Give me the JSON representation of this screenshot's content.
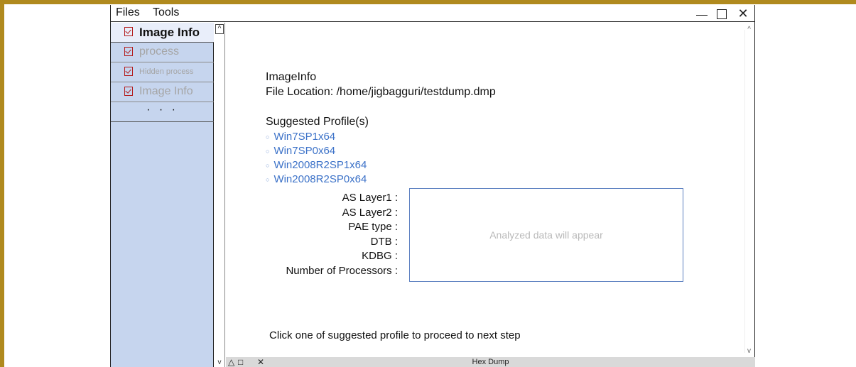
{
  "menu": {
    "files": "Files",
    "tools": "Tools"
  },
  "window_controls": {
    "minimize_icon": "minimize-icon",
    "maximize_icon": "maximize-icon",
    "close_glyph": "✕"
  },
  "sidebar": {
    "items": [
      {
        "label": "Image Info",
        "active": true
      },
      {
        "label": "process",
        "active": false
      },
      {
        "label": "Hidden process",
        "active": false
      },
      {
        "label": "Image Info",
        "active": false
      }
    ],
    "more_label": "· · ·"
  },
  "content": {
    "title": "ImageInfo",
    "file_location": "File Location: /home/jigbagguri/testdump.dmp",
    "suggested_heading": "Suggested Profile(s)",
    "profiles": [
      "Win7SP1x64",
      "Win7SP0x64",
      "Win2008R2SP1x64",
      "Win2008R2SP0x64"
    ],
    "fields": [
      "AS Layer1 :",
      "AS Layer2 :",
      "PAE type :",
      "DTB :",
      "KDBG :",
      "Number of Processors :"
    ],
    "placeholder": "Analyzed data will appear",
    "hint": "Click one of suggested profile to proceed to next step"
  },
  "bottom_panel": {
    "title": "Hex Dump",
    "up_glyph": "△",
    "max_glyph": "□",
    "close_glyph": "✕"
  },
  "colors": {
    "frame": "#b08a1e",
    "sidebar": "#c6d5ee",
    "profile_link": "#3c72c8",
    "checkbox": "#b31b1b"
  }
}
